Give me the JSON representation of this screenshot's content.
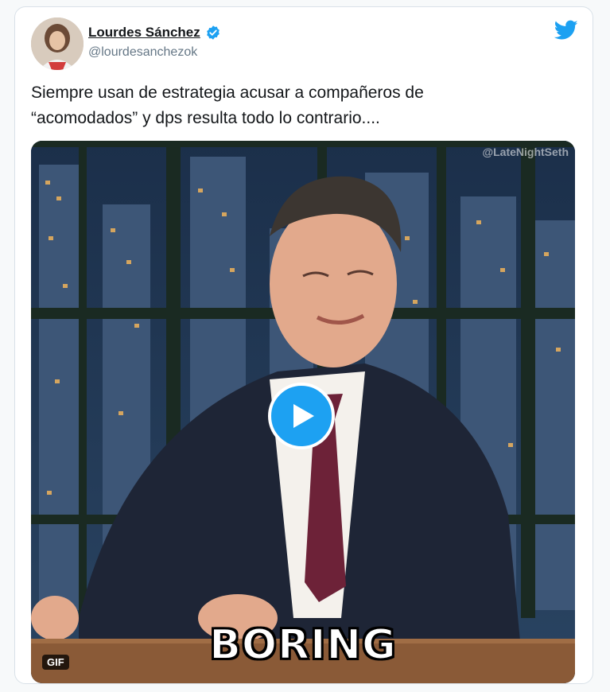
{
  "tweet": {
    "author": {
      "display_name": "Lourdes Sánchez",
      "handle": "@lourdesanchezok",
      "verified": true
    },
    "text": "Siempre usan de estrategia acusar a compañeros de\n“acomodados” y dps resulta todo lo contrario....",
    "media": {
      "type": "gif",
      "watermark": "@LateNightSeth",
      "caption": "BORING",
      "badge": "GIF"
    }
  },
  "icons": {
    "brand": "twitter-bird-icon",
    "verified": "verified-badge-icon",
    "play": "play-icon"
  },
  "colors": {
    "brand_blue": "#1da1f2",
    "text_primary": "#14171a",
    "text_secondary": "#657786",
    "border": "#d9e1e8"
  }
}
